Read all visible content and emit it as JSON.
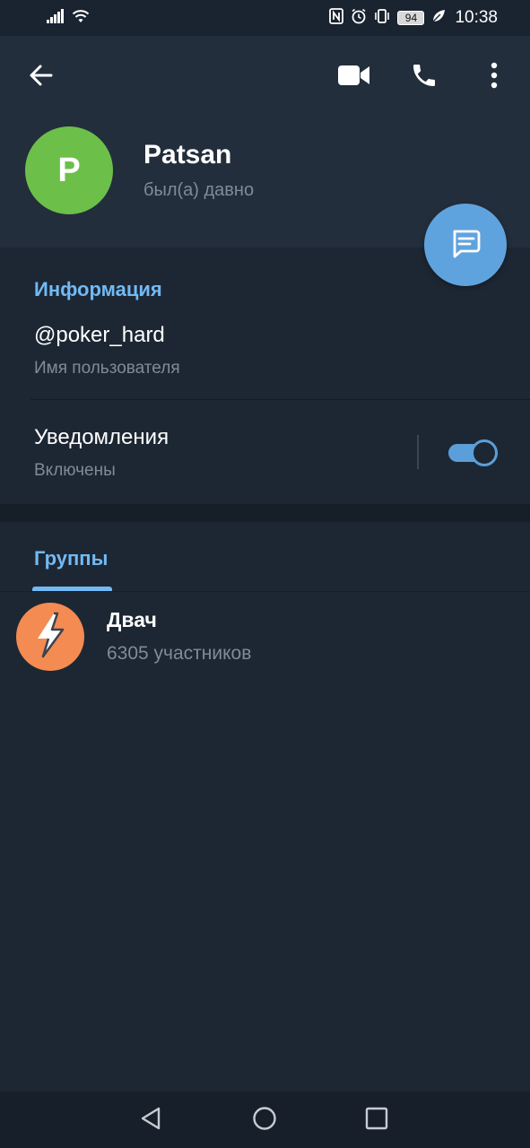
{
  "status_bar": {
    "battery": "94",
    "time": "10:38",
    "icons": [
      "signal-icon",
      "wifi-icon",
      "nfc-icon",
      "alarm-icon",
      "vibrate-icon",
      "battery-icon",
      "leaf-icon"
    ]
  },
  "toolbar": {
    "back_icon": "arrow-left-icon",
    "video_icon": "video-camera-icon",
    "call_icon": "phone-icon",
    "more_icon": "more-vertical-icon"
  },
  "profile": {
    "avatar_letter": "P",
    "avatar_color": "#6cc04a",
    "name": "Patsan",
    "last_seen": "был(а) давно"
  },
  "fab": {
    "icon": "message-icon",
    "color": "#5fa3de"
  },
  "info": {
    "title": "Информация",
    "username": "@poker_hard",
    "username_label": "Имя пользователя",
    "notifications_label": "Уведомления",
    "notifications_status": "Включены",
    "notifications_enabled": true
  },
  "groups": {
    "tab_label": "Группы",
    "items": [
      {
        "name": "Двач",
        "members": "6305 участников",
        "avatar_color": "#f38b52",
        "icon": "lightning-icon"
      }
    ]
  },
  "colors": {
    "accent": "#71baf5",
    "header_bg": "#232e3c",
    "body_bg": "#1d2733",
    "secondary_text": "#7f8b98"
  },
  "nav_bar": {
    "icons": [
      "back-triangle-icon",
      "home-circle-icon",
      "recents-square-icon"
    ]
  }
}
